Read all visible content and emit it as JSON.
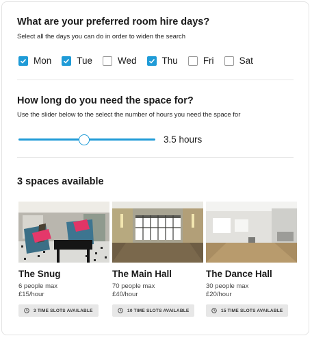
{
  "days_section": {
    "title": "What are your preferred room hire days?",
    "hint": "Select all the days you can do in order to widen the search",
    "days": [
      {
        "label": "Mon",
        "checked": true
      },
      {
        "label": "Tue",
        "checked": true
      },
      {
        "label": "Wed",
        "checked": false
      },
      {
        "label": "Thu",
        "checked": true
      },
      {
        "label": "Fri",
        "checked": false
      },
      {
        "label": "Sat",
        "checked": false
      }
    ]
  },
  "duration_section": {
    "title": "How long do you need the space for?",
    "hint": "Use the slider below to the select the number of hours you need the space for",
    "slider_fraction": 0.48,
    "value_label": "3.5 hours"
  },
  "results": {
    "title": "3 spaces available",
    "spaces": [
      {
        "name": "The Snug",
        "capacity": "6 people max",
        "price": "£15/hour",
        "slots": "3 TIME SLOTS AVAILABLE"
      },
      {
        "name": "The Main Hall",
        "capacity": "70 people max",
        "price": "£40/hour",
        "slots": "10 TIME SLOTS AVAILABLE"
      },
      {
        "name": "The Dance Hall",
        "capacity": "30 people max",
        "price": "£20/hour",
        "slots": "15 TIME SLOTS AVAILABLE"
      }
    ]
  },
  "colors": {
    "accent": "#1f9bd7"
  }
}
